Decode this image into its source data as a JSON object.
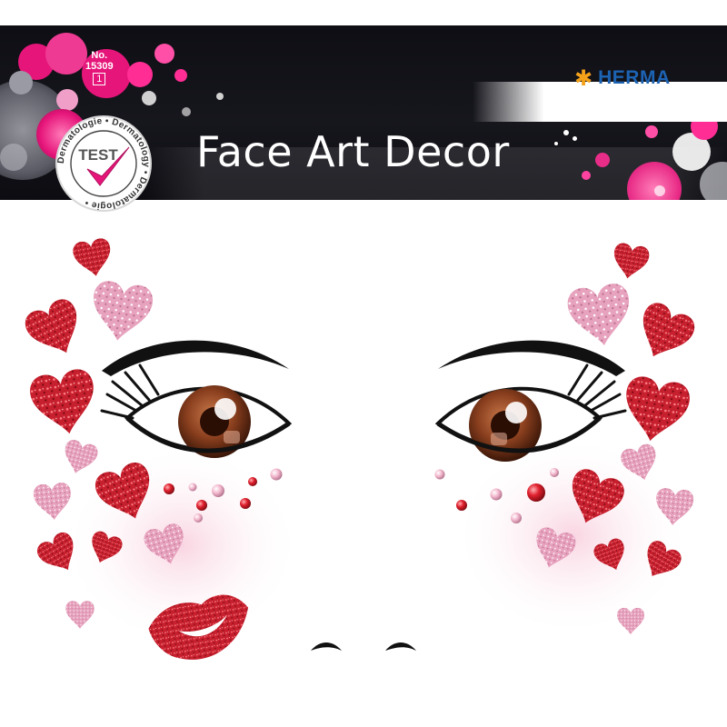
{
  "brand": {
    "name": "HERMA",
    "star_color": "#f4a21a",
    "name_color": "#1d63b3"
  },
  "product": {
    "title": "Face Art Decor",
    "number_label": "No.",
    "number": "15309",
    "quantity": "1"
  },
  "test_seal": {
    "center_text": "TEST",
    "ring_text": "Dermatologie • Dermatology • Dermatologie •"
  },
  "colors": {
    "header_bg": "#111118",
    "accent_pink": "#e6157a",
    "glitter_red": "#c8202e",
    "glitter_pink": "#e8a4bf",
    "iris": "#6b3018"
  },
  "icons": [
    "herma-star-icon",
    "test-checkmark-icon"
  ]
}
